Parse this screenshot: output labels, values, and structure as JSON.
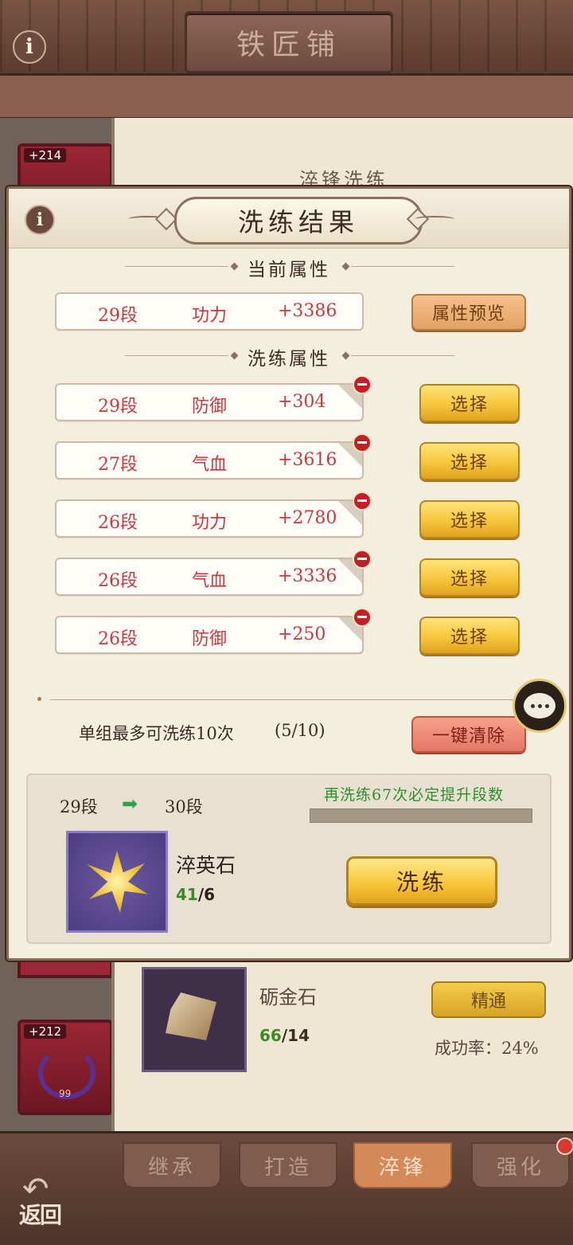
{
  "background": {
    "screen_title": "铁匠铺",
    "info_glyph": "i",
    "equipment": [
      {
        "tag": "+214"
      },
      {
        "tag": "+212",
        "level": "99"
      }
    ],
    "partial_level": "99",
    "subtitle": "淬锋洗练",
    "material": {
      "name": "砺金石",
      "count_have": "66",
      "count_need": "/14",
      "action_label": "精通",
      "rate_text": "成功率：24%"
    },
    "tabs": [
      {
        "label": "继承"
      },
      {
        "label": "打造"
      },
      {
        "label": "淬锋",
        "active": true
      },
      {
        "label": "强化"
      }
    ],
    "back_label": "返回"
  },
  "modal": {
    "title": "洗练结果",
    "info_glyph": "i",
    "current_section": "当前属性",
    "current": {
      "seg": "29段",
      "name": "功力",
      "value": "+3386"
    },
    "preview_button": "属性预览",
    "refine_section": "洗练属性",
    "options": [
      {
        "seg": "29段",
        "name": "防御",
        "value": "+304"
      },
      {
        "seg": "27段",
        "name": "气血",
        "value": "+3616"
      },
      {
        "seg": "26段",
        "name": "功力",
        "value": "+2780"
      },
      {
        "seg": "26段",
        "name": "气血",
        "value": "+3336"
      },
      {
        "seg": "26段",
        "name": "防御",
        "value": "+250"
      }
    ],
    "select_label": "选择",
    "limit_text": "单组最多可洗练10次",
    "limit_count": "(5/10)",
    "clear_button": "一键清除",
    "seg_from": "29段",
    "seg_to": "30段",
    "arrow_glyph": "➡",
    "guarantee_text": "再洗练67次必定提升段数",
    "guarantee_progress": 0.0,
    "stone": {
      "name": "淬英石",
      "count_have": "41",
      "count_need": "/6"
    },
    "refine_button": "洗练"
  },
  "colors": {
    "attr_text": "#d2363d",
    "gold_button": "#f6c63a",
    "progress_green": "#2f8f2c"
  },
  "icons": [
    "info-icon",
    "lock-icon",
    "arrow-right-icon",
    "chat-bubble-icon",
    "back-arrow-icon",
    "gem-stone-icon"
  ]
}
